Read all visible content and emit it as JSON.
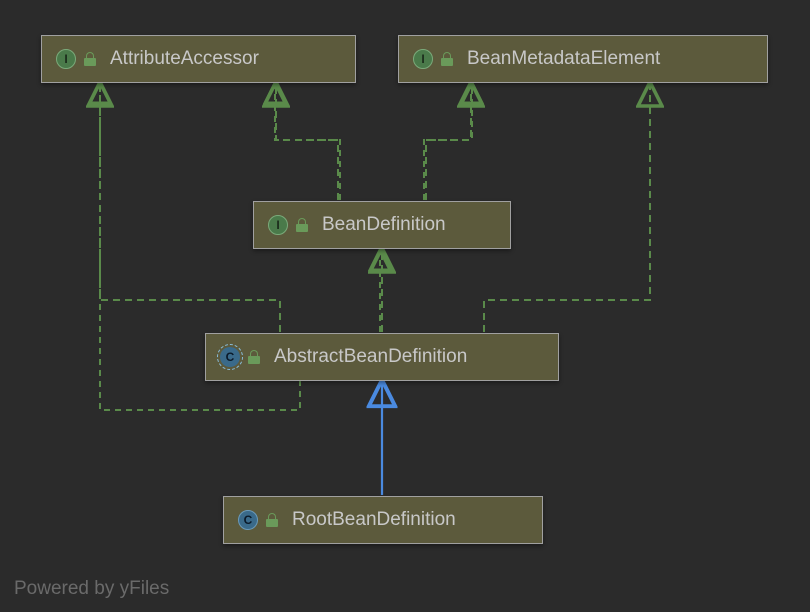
{
  "nodes": {
    "attributeAccessor": {
      "label": "AttributeAccessor",
      "badge": "I"
    },
    "beanMetadataElement": {
      "label": "BeanMetadataElement",
      "badge": "I"
    },
    "beanDefinition": {
      "label": "BeanDefinition",
      "badge": "I"
    },
    "abstractBeanDefinition": {
      "label": "AbstractBeanDefinition",
      "badge": "C"
    },
    "rootBeanDefinition": {
      "label": "RootBeanDefinition",
      "badge": "C"
    }
  },
  "edges": [
    {
      "from": "beanDefinition",
      "to": "attributeAccessor",
      "style": "dashed",
      "color": "green"
    },
    {
      "from": "beanDefinition",
      "to": "beanMetadataElement",
      "style": "dashed",
      "color": "green"
    },
    {
      "from": "abstractBeanDefinition",
      "to": "beanDefinition",
      "style": "dashed",
      "color": "green"
    },
    {
      "from": "abstractBeanDefinition",
      "to": "attributeAccessor",
      "style": "dashed",
      "color": "green"
    },
    {
      "from": "abstractBeanDefinition",
      "to": "beanMetadataElement",
      "style": "dashed",
      "color": "green"
    },
    {
      "from": "rootBeanDefinition",
      "to": "abstractBeanDefinition",
      "style": "solid",
      "color": "blue"
    }
  ],
  "footer": "Powered by yFiles",
  "colors": {
    "dashedEdge": "#5a8a4a",
    "solidEdge": "#4a8ae0"
  }
}
